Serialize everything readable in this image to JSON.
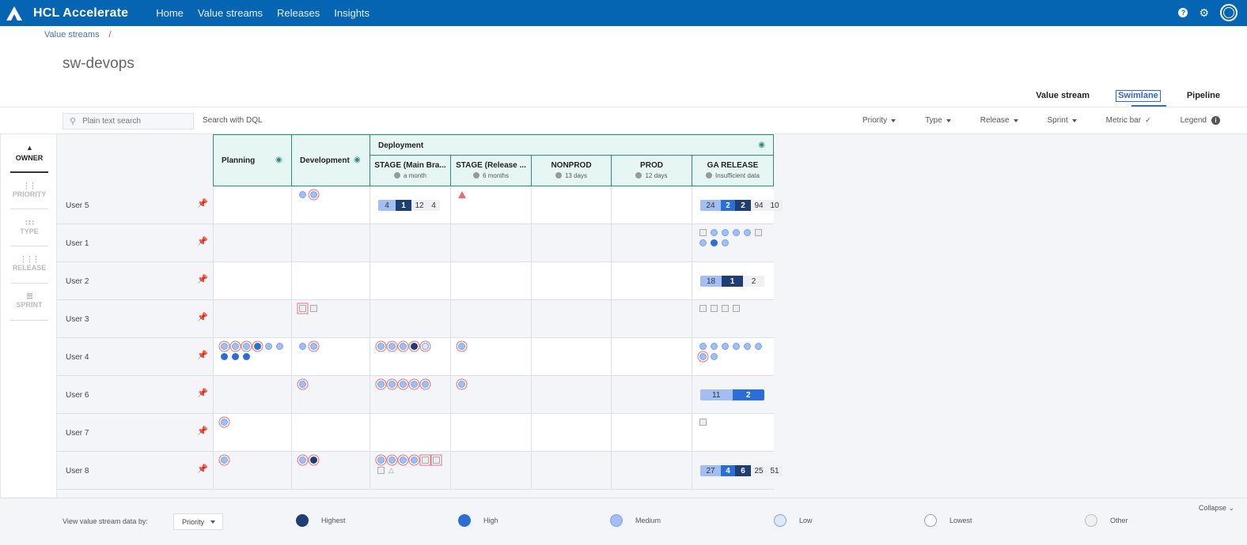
{
  "app": {
    "name": "HCL Accelerate"
  },
  "nav": [
    "Home",
    "Value streams",
    "Releases",
    "Insights"
  ],
  "breadcrumb": {
    "parent": "Value streams",
    "sep": "/"
  },
  "page_title": "sw-devops",
  "view_tabs": {
    "value_stream": "Value stream",
    "swimlane": "Swimlane",
    "pipeline": "Pipeline",
    "active": "Swimlane"
  },
  "toolbar": {
    "search_placeholder": "Plain text search",
    "dql": "Search with DQL",
    "filters": {
      "priority": "Priority",
      "type": "Type",
      "release": "Release",
      "sprint": "Sprint",
      "metric_bar": "Metric bar",
      "legend": "Legend"
    }
  },
  "group_by": {
    "owner": "OWNER",
    "priority": "PRIORITY",
    "type": "TYPE",
    "release": "RELEASE",
    "sprint": "SPRINT",
    "active": "OWNER"
  },
  "columns": {
    "planning": "Planning",
    "development": "Development",
    "deployment": "Deployment",
    "stages": [
      {
        "name": "STAGE (Main Bra...",
        "time": "a month"
      },
      {
        "name": "STAGE (Release ...",
        "time": "6 months"
      },
      {
        "name": "NONPROD",
        "time": "13 days"
      },
      {
        "name": "PROD",
        "time": "12 days"
      },
      {
        "name": "GA RELEASE",
        "time": "Insufficient data"
      }
    ]
  },
  "rows": [
    {
      "owner": "User 5",
      "pinned": true,
      "cells": [
        [],
        [
          "med",
          "med-r"
        ],
        {
          "bar": [
            [
              "med",
              4
            ],
            [
              "hst",
              1
            ],
            [
              "rest",
              12
            ],
            [
              "rest",
              4
            ]
          ]
        },
        [
          "tri"
        ],
        [],
        [],
        {
          "bar": [
            [
              "med",
              24
            ],
            [
              "hi",
              2
            ],
            [
              "hst",
              2
            ],
            [
              "rest",
              94
            ],
            [
              "rest",
              10
            ]
          ]
        }
      ]
    },
    {
      "owner": "User 1",
      "pinned": false,
      "cells": [
        [],
        [],
        [],
        [],
        [],
        [],
        [
          "sq",
          "med",
          "med",
          "med",
          "med",
          "sq",
          "med",
          "hi",
          "med"
        ]
      ]
    },
    {
      "owner": "User 2",
      "pinned": false,
      "cells": [
        [],
        [],
        [],
        [],
        [],
        [],
        {
          "bar": [
            [
              "med",
              18
            ],
            [
              "hst",
              1
            ],
            [
              "rest",
              2
            ]
          ]
        }
      ]
    },
    {
      "owner": "User 3",
      "pinned": false,
      "cells": [
        [],
        [
          "sq-r",
          "sq"
        ],
        [],
        [],
        [],
        [],
        [
          "sq",
          "sq",
          "sq",
          "sq"
        ]
      ]
    },
    {
      "owner": "User 4",
      "pinned": false,
      "cells": [
        [
          "med-r",
          "med-r",
          "med-r",
          "hi-r",
          "med",
          "med",
          "hi",
          "hi",
          "hi"
        ],
        [
          "med",
          "med-r"
        ],
        [
          "med-r",
          "med-r",
          "med-r",
          "hst-r",
          "low-r"
        ],
        [
          "med-r"
        ],
        [],
        [],
        [
          "med",
          "med",
          "med",
          "med",
          "med",
          "med",
          "med-r",
          "med"
        ]
      ]
    },
    {
      "owner": "User 6",
      "pinned": false,
      "cells": [
        [],
        [
          "med-r"
        ],
        [
          "med-r",
          "med-r",
          "med-r",
          "med-r",
          "med-r"
        ],
        [
          "med-r"
        ],
        [],
        [],
        {
          "bar": [
            [
              "med",
              11
            ],
            [
              "hi",
              2
            ]
          ]
        }
      ]
    },
    {
      "owner": "User 7",
      "pinned": false,
      "cells": [
        [
          "med-r"
        ],
        [],
        [],
        [],
        [],
        [],
        [
          "sq"
        ]
      ]
    },
    {
      "owner": "User 8",
      "pinned": false,
      "cells": [
        [
          "med-r"
        ],
        [
          "med-r",
          "hst-r"
        ],
        [
          "med-r",
          "med-r",
          "med-r",
          "med-r",
          "sq-r",
          "sq-r",
          "sq",
          "trig"
        ],
        [],
        [],
        [],
        {
          "bar": [
            [
              "med",
              27
            ],
            [
              "hi",
              4
            ],
            [
              "hst",
              6
            ],
            [
              "rest",
              25
            ],
            [
              "rest",
              51
            ]
          ]
        }
      ]
    }
  ],
  "footer": {
    "label": "View value stream data by:",
    "select": "Priority",
    "legend": [
      {
        "label": "Highest",
        "color": "#1f3e75"
      },
      {
        "label": "High",
        "color": "#2b6fd6"
      },
      {
        "label": "Medium",
        "color": "#a3bef2"
      },
      {
        "label": "Low",
        "color": "#dde8fb"
      },
      {
        "label": "Lowest",
        "color": "#ffffff"
      },
      {
        "label": "Other",
        "color": "#f0f0f0"
      }
    ],
    "collapse": "Collapse"
  }
}
